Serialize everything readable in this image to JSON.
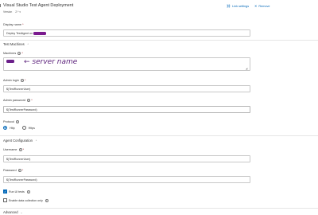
{
  "header": {
    "title": "Visual Studio Test Agent Deployment",
    "version_label": "Version",
    "version_value": "2.*",
    "link_settings_label": "Link settings",
    "remove_label": "Remove"
  },
  "display_name": {
    "label": "Display name",
    "value": "Deploy TestAgent on"
  },
  "test_machines": {
    "section_title": "Test Machines",
    "machines_label": "Machines",
    "annotation": "← server name",
    "admin_login_label": "Admin login",
    "admin_login_value": "$(TestRunnerUser)",
    "admin_password_label": "Admin password",
    "admin_password_value": "$(TestRunnerPassword)",
    "protocol_label": "Protocol",
    "protocol_options": [
      "Http",
      "Https"
    ],
    "protocol_selected": "Http"
  },
  "agent_configuration": {
    "section_title": "Agent Configuration",
    "username_label": "Username",
    "username_value": "$(TestRunnerUser)",
    "password_label": "Password",
    "password_value": "$(TestRunnerPassword)",
    "run_ui_tests_label": "Run UI tests",
    "run_ui_tests_checked": true,
    "enable_data_collection_label": "Enable data collection only",
    "enable_data_collection_checked": false
  },
  "advanced": {
    "section_title": "Advanced"
  },
  "colors": {
    "accent": "#0067b8",
    "redaction": "#7a1a8e",
    "required": "#a4262c"
  }
}
